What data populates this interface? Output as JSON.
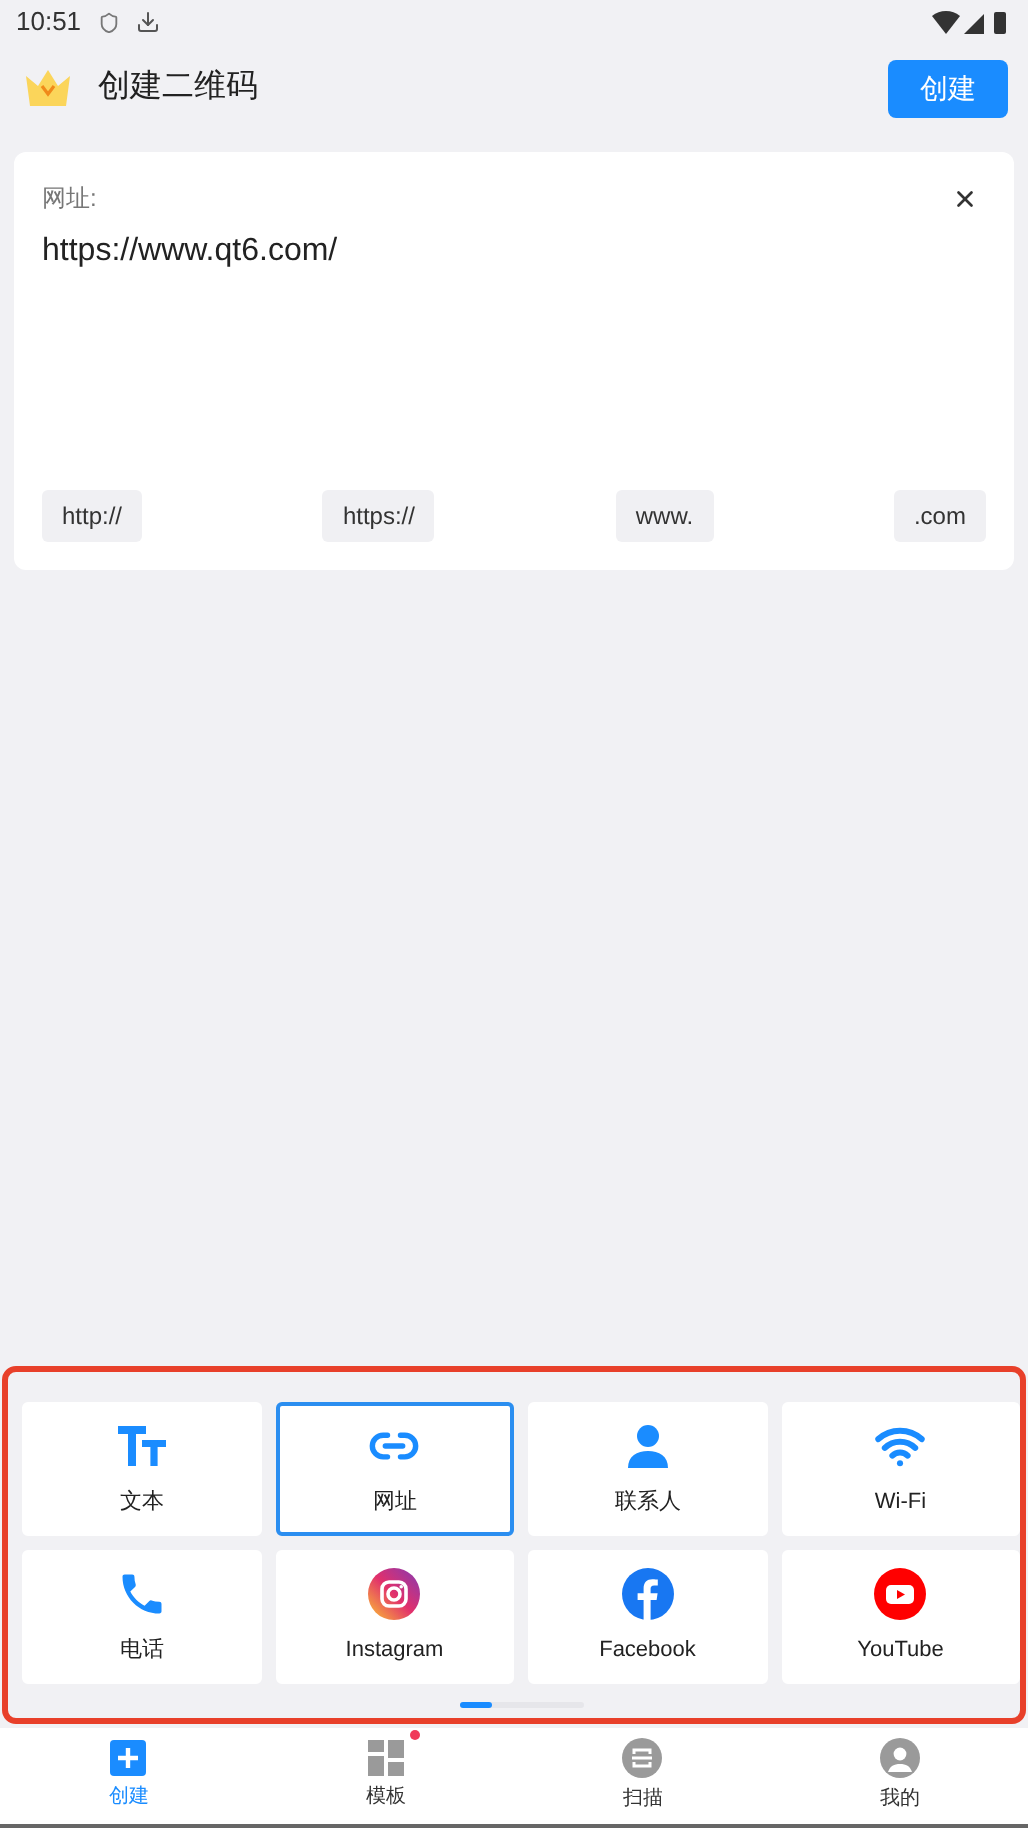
{
  "status_bar": {
    "time": "10:51"
  },
  "header": {
    "title": "创建二维码",
    "create_button": "创建"
  },
  "input_card": {
    "label": "网址:",
    "value": "https://www.qt6.com/",
    "shortcuts": [
      "http://",
      "https://",
      "www.",
      ".com"
    ]
  },
  "types": [
    {
      "kind": "text",
      "label": "文本",
      "selected": false
    },
    {
      "kind": "link",
      "label": "网址",
      "selected": true
    },
    {
      "kind": "contact",
      "label": "联系人",
      "selected": false
    },
    {
      "kind": "wifi",
      "label": "Wi-Fi",
      "selected": false
    },
    {
      "kind": "phone",
      "label": "电话",
      "selected": false
    },
    {
      "kind": "instagram",
      "label": "Instagram",
      "selected": false
    },
    {
      "kind": "facebook",
      "label": "Facebook",
      "selected": false
    },
    {
      "kind": "youtube",
      "label": "YouTube",
      "selected": false
    }
  ],
  "nav": [
    {
      "kind": "create",
      "label": "创建",
      "selected": true,
      "badge": false
    },
    {
      "kind": "templates",
      "label": "模板",
      "selected": false,
      "badge": true
    },
    {
      "kind": "scan",
      "label": "扫描",
      "selected": false,
      "badge": false
    },
    {
      "kind": "profile",
      "label": "我的",
      "selected": false,
      "badge": false
    }
  ]
}
